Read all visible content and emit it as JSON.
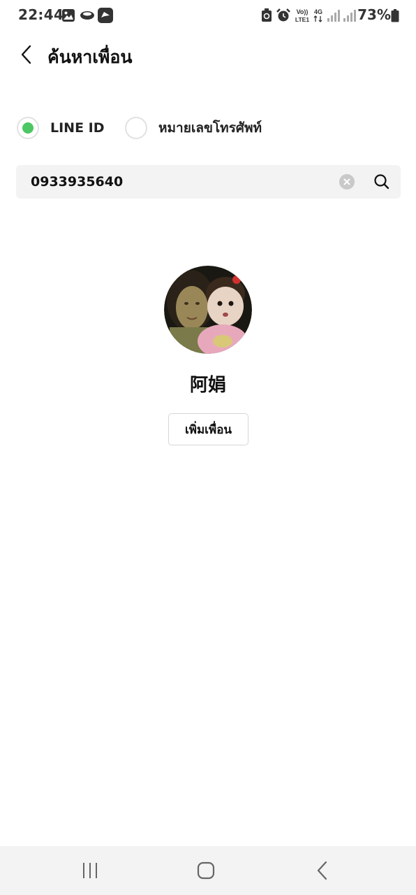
{
  "status_bar": {
    "time": "22:44",
    "battery": "73%",
    "icons": [
      "gallery-icon",
      "cloud-icon",
      "chat-app-icon",
      "recycle-icon",
      "alarm-icon",
      "volte-icon",
      "4g-icon",
      "signal-icon",
      "signal-icon",
      "battery-icon"
    ]
  },
  "header": {
    "title": "ค้นหาเพื่อน",
    "back_icon": "chevron-left-icon"
  },
  "search_type": {
    "options": [
      {
        "label": "LINE ID",
        "selected": true
      },
      {
        "label": "หมายเลขโทรศัพท์",
        "selected": false
      }
    ],
    "accent_color": "#4cc764"
  },
  "search": {
    "value": "0933935640",
    "clear_icon": "clear-icon",
    "search_icon": "search-icon"
  },
  "result": {
    "name": "阿娟",
    "add_button_label": "เพิ่มเพื่อน"
  },
  "nav_bar": {
    "buttons": [
      "recents-icon",
      "home-icon",
      "back-icon"
    ]
  }
}
